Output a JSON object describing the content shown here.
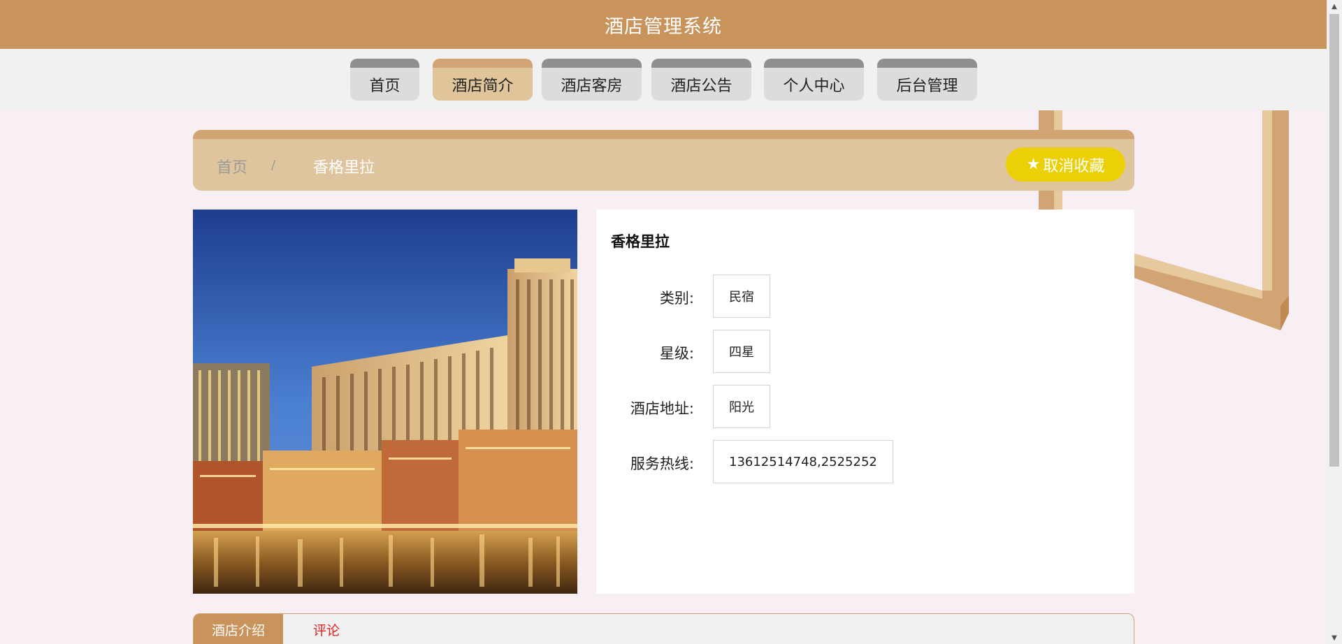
{
  "app": {
    "title": "酒店管理系统"
  },
  "nav": {
    "items": [
      {
        "label": "首页"
      },
      {
        "label": "酒店简介",
        "active": true
      },
      {
        "label": "酒店客房"
      },
      {
        "label": "酒店公告"
      },
      {
        "label": "个人中心"
      },
      {
        "label": "后台管理"
      }
    ]
  },
  "breadcrumb": {
    "home": "首页",
    "separator": "/",
    "current": "香格里拉"
  },
  "favorite": {
    "icon": "star-icon",
    "label": "取消收藏"
  },
  "hotel": {
    "name": "香格里拉",
    "fields": [
      {
        "label": "类别:",
        "value": "民宿"
      },
      {
        "label": "星级:",
        "value": "四星"
      },
      {
        "label": "酒店地址:",
        "value": "阳光"
      },
      {
        "label": "服务热线:",
        "value": "13612514748,2525252"
      }
    ]
  },
  "tabs": {
    "intro": "酒店介绍",
    "comment": "评论"
  },
  "colors": {
    "header": "#c9935c",
    "breadcrumb": "#dfc59d",
    "favorite": "#ecd007",
    "comment_tab": "#e02020"
  }
}
